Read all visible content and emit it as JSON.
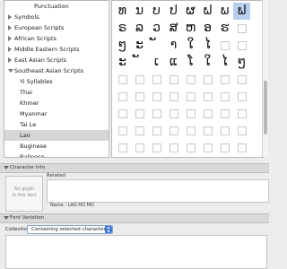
{
  "sidebar": {
    "items": [
      {
        "label": "Punctuation",
        "indent": 2,
        "expanded": null,
        "selected": false
      },
      {
        "label": "Symbols",
        "indent": 0,
        "expanded": false,
        "selected": false
      },
      {
        "label": "European Scripts",
        "indent": 0,
        "expanded": false,
        "selected": false
      },
      {
        "label": "African Scripts",
        "indent": 0,
        "expanded": false,
        "selected": false
      },
      {
        "label": "Middle Eastern Scripts",
        "indent": 0,
        "expanded": false,
        "selected": false
      },
      {
        "label": "East Asian Scripts",
        "indent": 0,
        "expanded": false,
        "selected": false
      },
      {
        "label": "Southeast Asian Scripts",
        "indent": 0,
        "expanded": true,
        "selected": false
      },
      {
        "label": "Yi Syllables",
        "indent": 1,
        "expanded": null,
        "selected": false
      },
      {
        "label": "Thai",
        "indent": 1,
        "expanded": null,
        "selected": false
      },
      {
        "label": "Khmer",
        "indent": 1,
        "expanded": null,
        "selected": false
      },
      {
        "label": "Myanmar",
        "indent": 1,
        "expanded": null,
        "selected": false
      },
      {
        "label": "Tai Le",
        "indent": 1,
        "expanded": null,
        "selected": false
      },
      {
        "label": "Lao",
        "indent": 1,
        "expanded": null,
        "selected": true
      },
      {
        "label": "Buginese",
        "indent": 1,
        "expanded": null,
        "selected": false
      },
      {
        "label": "Balinese",
        "indent": 1,
        "expanded": null,
        "selected": false
      }
    ]
  },
  "grid": {
    "columns": 8,
    "rows": [
      [
        "ທ",
        "ນ",
        "ບ",
        "ປ",
        "ຜ",
        "ຝ",
        "ພ",
        "ຟ"
      ],
      [
        "ຣ",
        "ລ",
        "ວ",
        "ສ",
        "ຫ",
        "ອ",
        "ຮ",
        "",
        ""
      ],
      [
        "ໆ",
        "ະ",
        "ັ",
        "າ",
        "ໃ",
        "ໄ",
        "",
        ""
      ],
      [
        "ະ",
        "ັ",
        "ເ",
        "ແ",
        "ໂ",
        "ໃ",
        "ໄ",
        "ໆ"
      ],
      [
        "",
        "",
        "",
        "",
        "",
        "",
        "",
        ""
      ],
      [
        "",
        "",
        "",
        "",
        "",
        "",
        "",
        ""
      ],
      [
        "",
        "",
        "",
        "",
        "",
        "",
        "",
        ""
      ],
      [
        "",
        "",
        "",
        "",
        "",
        "",
        "",
        ""
      ],
      [
        "",
        "",
        "",
        "",
        "",
        "",
        "",
        ""
      ]
    ],
    "selected_cell": {
      "row": 0,
      "col": 7
    }
  },
  "character_info": {
    "header": "Character Info",
    "no_glyph_line1": "No glyph",
    "no_glyph_line2": "in this font",
    "related_label": "Related",
    "name_text": "Name : LAO HO MO"
  },
  "font_variation": {
    "header": "Font Variation",
    "collections_label": "Collections :",
    "collections_value": "Containing selected character"
  }
}
